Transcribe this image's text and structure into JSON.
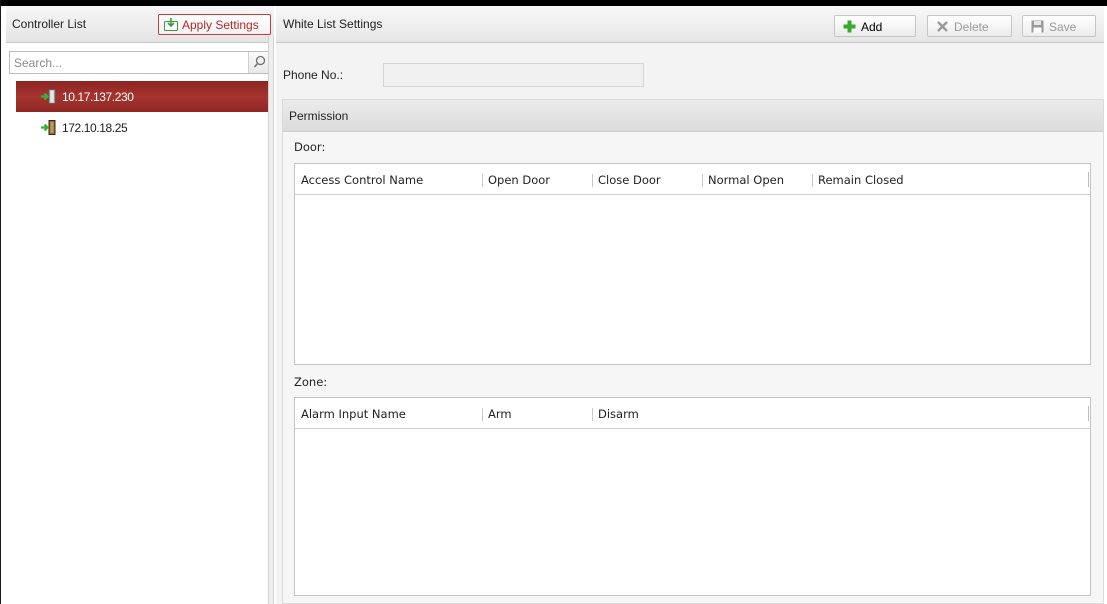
{
  "left_panel": {
    "title": "Controller List",
    "apply_button": "Apply Settings",
    "search_placeholder": "Search...",
    "controllers": [
      {
        "label": "10.17.137.230",
        "selected": true
      },
      {
        "label": "172.10.18.25",
        "selected": false
      }
    ]
  },
  "right_panel": {
    "title": "White List Settings",
    "toolbar": {
      "add": "Add",
      "delete": "Delete",
      "save": "Save"
    },
    "phone_label": "Phone No.:",
    "phone_value": "",
    "permission": {
      "title": "Permission",
      "door_label": "Door:",
      "door_columns": [
        "Access Control Name",
        "Open Door",
        "Close Door",
        "Normal Open",
        "Remain Closed"
      ],
      "zone_label": "Zone:",
      "zone_columns": [
        "Alarm Input Name",
        "Arm",
        "Disarm"
      ]
    }
  },
  "icons": {
    "apply": "apply-settings-icon",
    "search": "search-icon",
    "controller": "door-controller-icon",
    "add": "plus-icon",
    "delete": "x-icon",
    "save": "floppy-disk-icon"
  },
  "colors": {
    "selection": "#9a2e2a",
    "accent_red": "#c04040",
    "add_green": "#3aa82e"
  }
}
